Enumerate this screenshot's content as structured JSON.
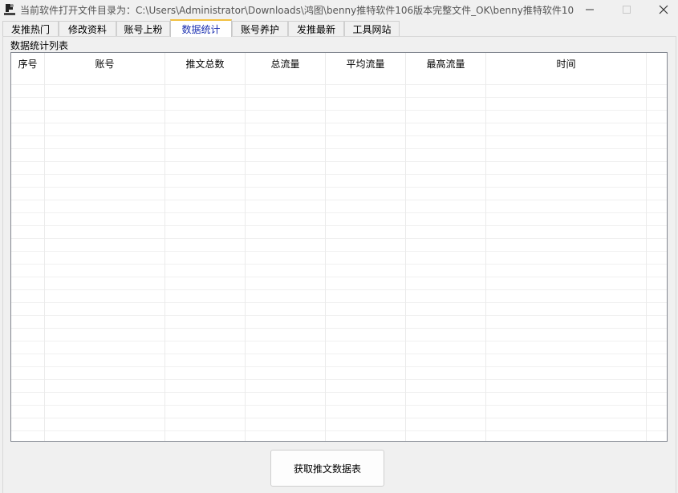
{
  "window": {
    "title": "当前软件打开文件目录为：C:\\Users\\Administrator\\Downloads\\鸿图\\benny推特软件106版本完整文件_OK\\benny推特软件106版..."
  },
  "tabs": [
    {
      "label": "发推热门"
    },
    {
      "label": "修改资料"
    },
    {
      "label": "账号上粉"
    },
    {
      "label": "数据统计"
    },
    {
      "label": "账号养护"
    },
    {
      "label": "发推最新"
    },
    {
      "label": "工具网站"
    }
  ],
  "active_tab": "数据统计",
  "group": {
    "label": "数据统计列表"
  },
  "table": {
    "columns": [
      "序号",
      "账号",
      "推文总数",
      "总流量",
      "平均流量",
      "最高流量",
      "时间"
    ],
    "rows": []
  },
  "actions": {
    "fetch_button": "获取推文数据表"
  }
}
